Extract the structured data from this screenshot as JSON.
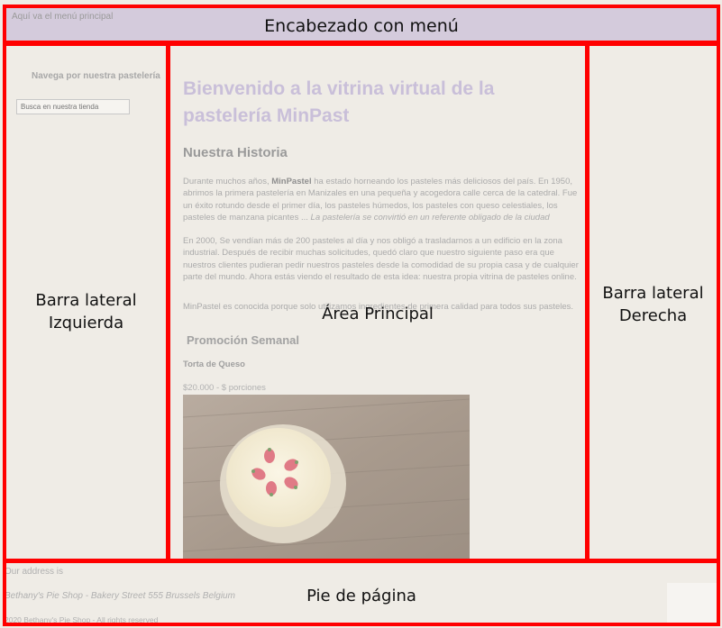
{
  "header": {
    "menu_note": "Aquí va el menú principal",
    "label": "Encabezado con menú"
  },
  "left_sidebar": {
    "nav_title": "Navega por nuestra pastelería",
    "search_placeholder": "Busca en nuestra tienda",
    "label_line1": "Barra lateral",
    "label_line2": "Izquierda"
  },
  "main": {
    "title": "Bienvenido a la vitrina virtual de la pastelería MinPast",
    "history_heading": "Nuestra Historia",
    "p1_part1": "Durante muchos años, ",
    "p1_brand": "MinPastel",
    "p1_part2": " ha estado horneando los pasteles más deliciosos del país. En 1950, abrimos la primera pastelería en Manizales en una pequeña y acogedora calle cerca de la catedral. Fue un éxito rotundo desde el primer día, los pasteles húmedos, los pasteles con queso celestiales, los pasteles de manzana picantes ... ",
    "p1_italic": "La pastelería se convirtió en un referente obligado de la ciudad",
    "p2": "En 2000, Se vendían más de 200 pasteles al día y nos obligó a trasladarnos a un edificio en la zona industrial. Después de recibir muchas solicitudes, quedó claro que nuestro siguiente paso era que nuestros clientes pudieran pedir nuestros pasteles desde la comodidad de su propia casa y de cualquier parte del mundo. Ahora estás viendo el resultado de esta idea: nuestra propia vitrina de pasteles online.",
    "p3": "MinPastel es conocida porque solo utilizamos ingredientes de primera calidad para todos sus pasteles.",
    "promo_heading": "Promoción Semanal",
    "cake_name": "Torta de Queso",
    "cake_price": "$20.000 - $ porciones",
    "label": "Área Principal"
  },
  "right_sidebar": {
    "label_line1": "Barra lateral",
    "label_line2": "Derecha"
  },
  "footer": {
    "address_intro": "Our address is",
    "address": "Bethany's Pie Shop - Bakery Street 555 Brussels Belgium",
    "copyright": "2020 Bethany's Pie Shop - All rights reserved",
    "label": "Pie de página"
  },
  "colors": {
    "border": "#ff0000",
    "header_bg": "#d4cbdc",
    "page_bg": "#efece6",
    "title_color": "#c9bfd9"
  }
}
